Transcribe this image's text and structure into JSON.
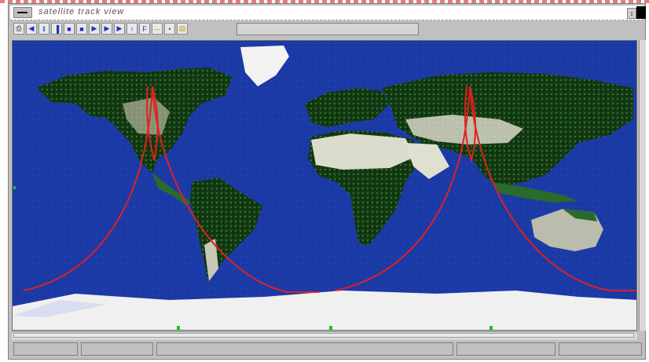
{
  "window": {
    "title": "satellite track view",
    "system_menu_icon": "window-menu-icon",
    "restore_label": "↕"
  },
  "toolbar": {
    "tools": [
      {
        "name": "print-icon",
        "glyph": "⎙"
      },
      {
        "name": "step-back-icon",
        "glyph": "◀"
      },
      {
        "name": "pause-icon",
        "glyph": "‖"
      },
      {
        "name": "frame-back-icon",
        "glyph": "▐"
      },
      {
        "name": "stop-icon",
        "glyph": "■"
      },
      {
        "name": "stop-square-icon",
        "glyph": "■"
      },
      {
        "name": "play-icon",
        "glyph": "▶"
      },
      {
        "name": "step-forward-icon",
        "glyph": "▶"
      },
      {
        "name": "fast-forward-icon",
        "glyph": "▶"
      },
      {
        "name": "pin-icon",
        "glyph": "↑"
      },
      {
        "name": "flag-icon",
        "glyph": "F"
      },
      {
        "name": "line-icon",
        "glyph": "—"
      },
      {
        "name": "marker-red-icon",
        "glyph": "•"
      },
      {
        "name": "folder-icon",
        "glyph": "▤"
      }
    ],
    "field_value": ""
  },
  "map": {
    "ocean_color": "#1c3aa6",
    "land_color": "#123b12",
    "ice_color": "#f0f0f0",
    "desert_color": "#d8d8c8",
    "track_color": "#e02020"
  },
  "status": {
    "pane1": "",
    "pane2": "",
    "pane3": "",
    "pane4": "",
    "pane5": ""
  }
}
